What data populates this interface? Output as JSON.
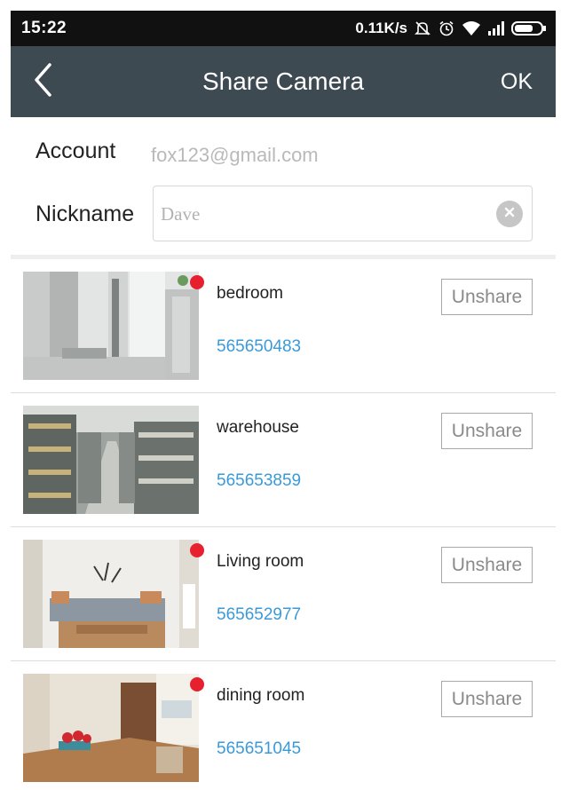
{
  "status_bar": {
    "time": "15:22",
    "speed": "0.11K/s",
    "icons": [
      "muted-bell-icon",
      "alarm-clock-icon",
      "wifi-icon",
      "signal-bars-icon",
      "battery-icon"
    ]
  },
  "header": {
    "back_icon": "chevron-left-icon",
    "title": "Share Camera",
    "ok_label": "OK",
    "background": "#3d4a52"
  },
  "form": {
    "account_label": "Account",
    "account_value": "fox123@gmail.com",
    "nickname_label": "Nickname",
    "nickname_value": "",
    "nickname_placeholder": "Dave",
    "clear_icon": "clear-circle-icon"
  },
  "cameras": [
    {
      "name": "bedroom",
      "id": "565650483",
      "unshare_label": "Unshare",
      "has_new_dot": true
    },
    {
      "name": "warehouse",
      "id": "565653859",
      "unshare_label": "Unshare",
      "has_new_dot": false
    },
    {
      "name": "Living room",
      "id": "565652977",
      "unshare_label": "Unshare",
      "has_new_dot": true
    },
    {
      "name": "dining room",
      "id": "565651045",
      "unshare_label": "Unshare",
      "has_new_dot": true
    }
  ],
  "colors": {
    "camera_id": "#3a9ad9",
    "new_dot": "#e6202e",
    "status_bar": "#111111"
  }
}
